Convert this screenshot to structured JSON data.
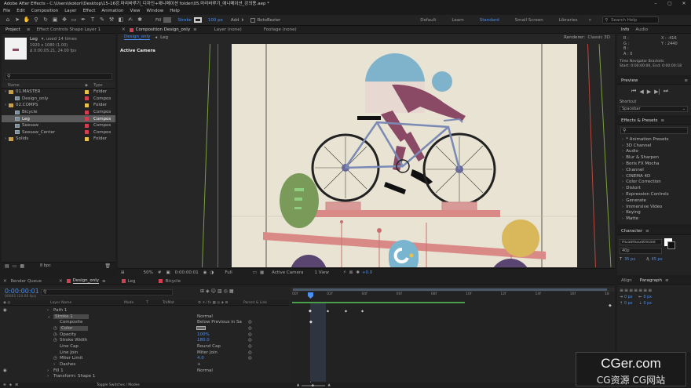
{
  "titlebar": {
    "title": "Adobe After Effects - C:\\Users\\kokori\\Desktop\\15-16강.마리바루기_디자인+애니메이션 folder\\05.마리바루기_애니메이션_강의용.aep *"
  },
  "menu": [
    "File",
    "Edit",
    "Composition",
    "Layer",
    "Effect",
    "Animation",
    "View",
    "Window",
    "Help"
  ],
  "toolbar": {
    "fill_label": "Fill",
    "stroke_label": "Stroke",
    "stroke_width": "100 px",
    "add_label": "Add",
    "rotobezier_label": "RotoBezier",
    "workspaces": [
      "Default",
      "Learn",
      "Standard",
      "Small Screen",
      "Libraries"
    ],
    "active_workspace": "Standard",
    "search_placeholder": "Search Help"
  },
  "project_panel": {
    "tabs": [
      "Project",
      "Effect Controls Shape Layer 1"
    ],
    "item_name": "Leg",
    "item_used": "▾, used 14 times",
    "item_size": "1920 x 1080 (1.00)",
    "item_duration": "Δ 0:00:05:21, 24.00 fps",
    "col_name": "Name",
    "col_type": "Type",
    "rows": [
      {
        "name": "01.MASTER",
        "type": "Folder",
        "kind": "folder",
        "indent": 0,
        "label": "#e8c04a"
      },
      {
        "name": "Design_only",
        "type": "Compos",
        "kind": "comp",
        "indent": 1,
        "label": "#d04050"
      },
      {
        "name": "02.COMPS",
        "type": "Folder",
        "kind": "folder",
        "indent": 0,
        "label": "#e8c04a"
      },
      {
        "name": "Bicycle",
        "type": "Compos",
        "kind": "comp",
        "indent": 1,
        "label": "#d04050"
      },
      {
        "name": "Leg",
        "type": "Compos",
        "kind": "comp",
        "indent": 1,
        "label": "#d04050",
        "selected": true
      },
      {
        "name": "Seesaw",
        "type": "Compos",
        "kind": "comp",
        "indent": 1,
        "label": "#d04050"
      },
      {
        "name": "Seesaw_Center",
        "type": "Compos",
        "kind": "comp",
        "indent": 1,
        "label": "#d04050"
      },
      {
        "name": "Solids",
        "type": "Folder",
        "kind": "folder",
        "indent": 0,
        "label": "#e8c04a"
      }
    ],
    "footer": "8 bpc"
  },
  "comp_panel": {
    "tab_label": "Composition Design_only",
    "layer_tab": "Layer (none)",
    "footage_tab": "Footage (none)",
    "subtabs": [
      "Design_only",
      "Leg"
    ],
    "renderer_label": "Renderer:",
    "renderer_value": "Classic 3D",
    "active_camera": "Active Camera",
    "footer": {
      "zoom": "50%",
      "time": "0:00:00:01",
      "quality": "Full",
      "camera": "Active Camera",
      "view": "1 View",
      "offset": "+0.0"
    }
  },
  "right_panels": {
    "info_tab": "Info",
    "audio_tab": "Audio",
    "info_rgb": [
      "R :",
      "G :",
      "B :",
      "A : 0"
    ],
    "info_xy": [
      "X : -416",
      "Y : 2440"
    ],
    "info_line1": "Time Navigator Brackets",
    "info_line2": "Start: 0:00:00:00, End: 0:00:00:18",
    "preview_tab": "Preview",
    "shortcut_label": "Shortcut",
    "shortcut_value": "Spacebar",
    "effects_tab": "Effects & Presets",
    "effects": [
      "* Animation Presets",
      "3D Channel",
      "Audio",
      "Blur & Sharpen",
      "Boris FX Mocha",
      "Channel",
      "CINEMA 4D",
      "Color Correction",
      "Distort",
      "Expression Controls",
      "Generate",
      "Immersive Video",
      "Keying",
      "Matte"
    ],
    "character_tab": "Character",
    "font_value": "HGSoftGGothicsst",
    "font_style": "40p",
    "char_size": "35 px",
    "char_leading": "45 px",
    "align_tab": "Align",
    "paragraph_tab": "Paragraph",
    "para_values": [
      "0 px",
      "0 px",
      "0 px",
      "0 px",
      "0 px"
    ]
  },
  "timeline": {
    "tabs": [
      "Render Queue",
      "Design_only",
      "Leg",
      "Bicycle"
    ],
    "active_tab": "Design_only",
    "timecode": "0:00:00:01",
    "fps_note": "00001 (24.00 fps)",
    "col_layer": "Layer Name",
    "col_mode": "Mode",
    "col_trkmat": "TrkMat",
    "col_parent": "Parent & Link",
    "ruler": [
      "00f",
      "02f",
      "04f",
      "06f",
      "08f",
      "10f",
      "12f",
      "14f",
      "16f",
      "18"
    ],
    "rows": [
      {
        "name": "Path 1",
        "indent": 1,
        "value": "",
        "arrow": true
      },
      {
        "name": "Stroke 1",
        "indent": 1,
        "value": "Normal",
        "arrow": true,
        "sel": true
      },
      {
        "name": "Composite",
        "indent": 2,
        "value": "Below Previous in Sa"
      },
      {
        "name": "Color",
        "indent": 2,
        "value": "",
        "stopwatch": true,
        "sel": true,
        "swatch": true
      },
      {
        "name": "Opacity",
        "indent": 2,
        "value": "100%",
        "stopwatch": true,
        "blue": true
      },
      {
        "name": "Stroke Width",
        "indent": 2,
        "value": "180.0",
        "stopwatch": true,
        "blue": true
      },
      {
        "name": "Line Cap",
        "indent": 2,
        "value": "Round Cap"
      },
      {
        "name": "Line Join",
        "indent": 2,
        "value": "Miter Join"
      },
      {
        "name": "Miter Limit",
        "indent": 2,
        "value": "4.0",
        "stopwatch": true,
        "blue": true
      },
      {
        "name": "Dashes",
        "indent": 2,
        "value": "+",
        "arrow": true
      },
      {
        "name": "Fill 1",
        "indent": 1,
        "value": "Normal",
        "arrow": true
      },
      {
        "name": "Transform: Shape 1",
        "indent": 1,
        "value": "",
        "arrow": true
      }
    ],
    "footer": "Toggle Switches / Modes"
  },
  "watermark": {
    "line1": "CGer.com",
    "line2": "CG资源 CG网站"
  },
  "colors": {
    "accent": "#4b8ff0",
    "canvas_bg": "#e8e3d2",
    "sun": "#7fb3cc",
    "rider": "#8a4a66",
    "seesaw": "#d98a86",
    "tree_green": "#7a9a5a",
    "tree_yellow": "#d8b85a",
    "cactus": "#7ab5d0"
  }
}
